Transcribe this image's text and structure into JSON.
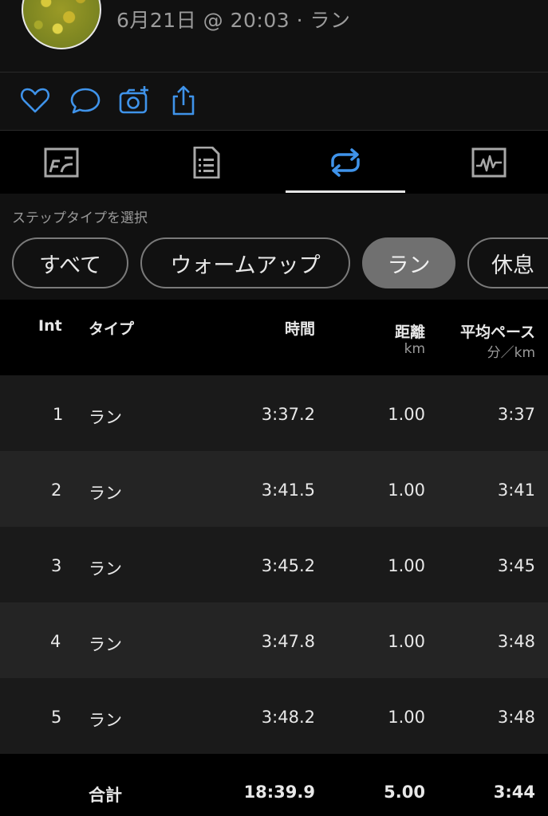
{
  "header": {
    "activity_meta": "6月21日 @ 20:03 · ラン"
  },
  "actions": [
    {
      "icon": "heart-icon"
    },
    {
      "icon": "comment-icon"
    },
    {
      "icon": "add-photo-icon"
    },
    {
      "icon": "share-icon"
    }
  ],
  "tabs": [
    {
      "icon": "map-icon"
    },
    {
      "icon": "details-list-icon"
    },
    {
      "icon": "laps-repeat-icon",
      "active": true
    },
    {
      "icon": "graph-icon"
    }
  ],
  "accent_color": "#3f93ea",
  "step_filter": {
    "label": "ステップタイプを選択",
    "chips": [
      "すべて",
      "ウォームアップ",
      "ラン",
      "休息"
    ],
    "selected": "ラン"
  },
  "table": {
    "headers": {
      "int": "Int",
      "type": "タイプ",
      "time": "時間",
      "distance": "距離",
      "distance_unit": "km",
      "avg_pace": "平均ペース",
      "avg_pace_unit": "分／km"
    },
    "rows": [
      {
        "int": "1",
        "type": "ラン",
        "time": "3:37.2",
        "distance": "1.00",
        "pace": "3:37"
      },
      {
        "int": "2",
        "type": "ラン",
        "time": "3:41.5",
        "distance": "1.00",
        "pace": "3:41"
      },
      {
        "int": "3",
        "type": "ラン",
        "time": "3:45.2",
        "distance": "1.00",
        "pace": "3:45"
      },
      {
        "int": "4",
        "type": "ラン",
        "time": "3:47.8",
        "distance": "1.00",
        "pace": "3:48"
      },
      {
        "int": "5",
        "type": "ラン",
        "time": "3:48.2",
        "distance": "1.00",
        "pace": "3:48"
      }
    ],
    "total": {
      "label": "合計",
      "time": "18:39.9",
      "distance": "5.00",
      "pace": "3:44"
    }
  }
}
